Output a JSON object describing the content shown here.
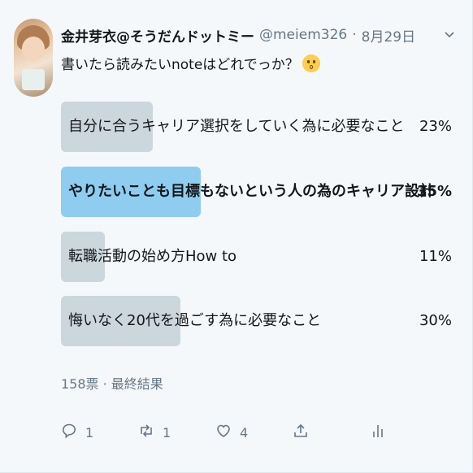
{
  "tweet": {
    "display_name": "金井芽衣@そうだんドットミー",
    "handle": "@meiem326",
    "separator": "·",
    "date": "8月29日",
    "text": "書いたら読みたいnoteはどれでっか？"
  },
  "poll": {
    "options": [
      {
        "label": "自分に合うキャリア選択をしていく為に必要なこと",
        "percent": "23%",
        "fraction": 0.23
      },
      {
        "label": "やりたいことも目標もないという人の為のキャリア設計",
        "percent": "35%",
        "fraction": 0.35,
        "winner": true
      },
      {
        "label": "転職活動の始め方How to",
        "percent": "11%",
        "fraction": 0.11
      },
      {
        "label": "悔いなく20代を過ごす為に必要なこと",
        "percent": "30%",
        "fraction": 0.3
      }
    ],
    "summary": "158票 · 最終結果"
  },
  "actions": {
    "reply_count": "1",
    "retweet_count": "1",
    "like_count": "4"
  },
  "colors": {
    "bar": "#ccd6dd",
    "winner_bar": "#8ecdf0",
    "muted_text": "#657786"
  }
}
